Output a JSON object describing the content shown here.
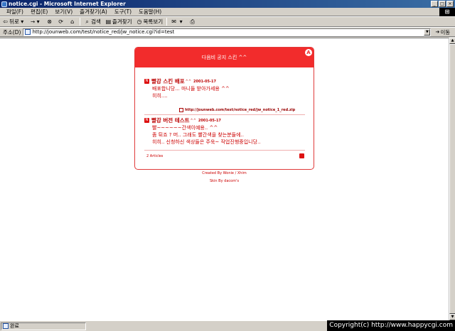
{
  "window": {
    "title": "notice.cgi - Microsoft Internet Explorer",
    "minimize": "_",
    "maximize": "□",
    "close": "×"
  },
  "menu": [
    "파일(F)",
    "편집(E)",
    "보기(V)",
    "즐겨찾기(A)",
    "도구(T)",
    "도움말(H)"
  ],
  "toolbar": {
    "back": "뒤로",
    "forward": "→",
    "search": "검색",
    "favorites": "즐겨찾기",
    "history": "목록보기"
  },
  "address": {
    "label": "주소(D)",
    "url": "http://jounweb.com/test/notice_red/jw_notice.cgi?id=test",
    "go": "이동"
  },
  "notice": {
    "header": "다음비 공지 스킨 ^^",
    "posts": [
      {
        "title": "빨강 스킨 배포",
        "suffix": "^^",
        "date": "2001-05-17",
        "lines": [
          "배포합니당... 마니들 받아가세용 ^^",
          "히히...."
        ],
        "attachment": "http://jounweb.com/test/notice_red/jw_notice_1_red.zip"
      },
      {
        "title": "빨강 버전 테스트",
        "suffix": "^^",
        "date": "2001-05-17",
        "lines": [
          "빨~~~~~~간색이예용.. ^^",
          "좀 튀죠 ? 머.. 그래도 빨간색을 찾는분들에..",
          "히히.. 신청하신 색상들은 주욱~ 작업진행중입니당.."
        ]
      }
    ],
    "count": "2 Articles"
  },
  "credits": {
    "created": "Created By Wonie / Xhim",
    "skin": "Skin By dacom's"
  },
  "status": {
    "text": "완료",
    "copyright": "Copyright(c) http://www.happycgi.com"
  }
}
